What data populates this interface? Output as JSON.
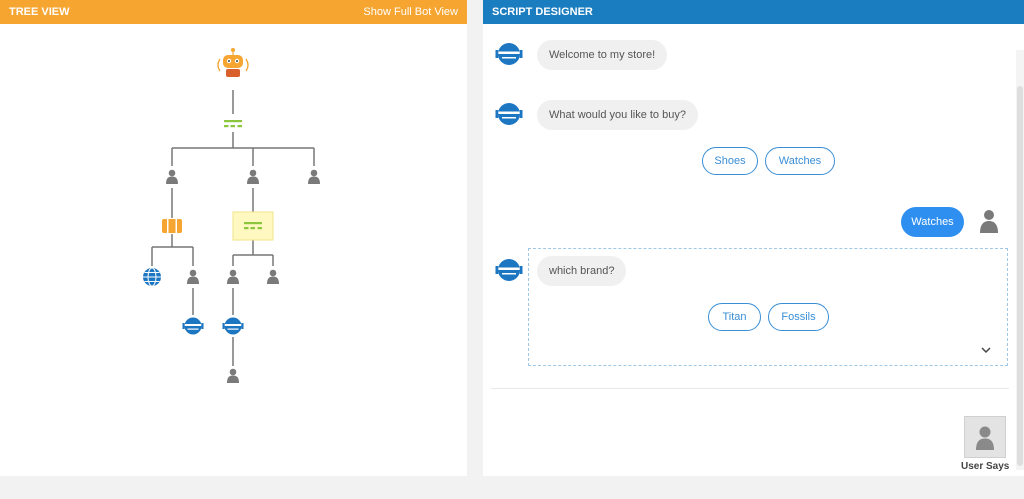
{
  "tree_view": {
    "title": "TREE VIEW",
    "show_full_link": "Show Full Bot View"
  },
  "script_designer": {
    "title": "SCRIPT DESIGNER",
    "messages": {
      "welcome": "Welcome to my store!",
      "question": "What would you like to buy?",
      "brand_question": "which brand?"
    },
    "options_category": [
      "Shoes",
      "Watches"
    ],
    "user_reply": "Watches",
    "options_brand": [
      "Titan",
      "Fossils"
    ],
    "user_says_label": "User Says"
  },
  "colors": {
    "tree_header": "#f6a531",
    "designer_header": "#1a7dc0",
    "accent_blue": "#2f8ff0",
    "node_green": "#8cc63f",
    "node_gray": "#7a7a7a"
  }
}
